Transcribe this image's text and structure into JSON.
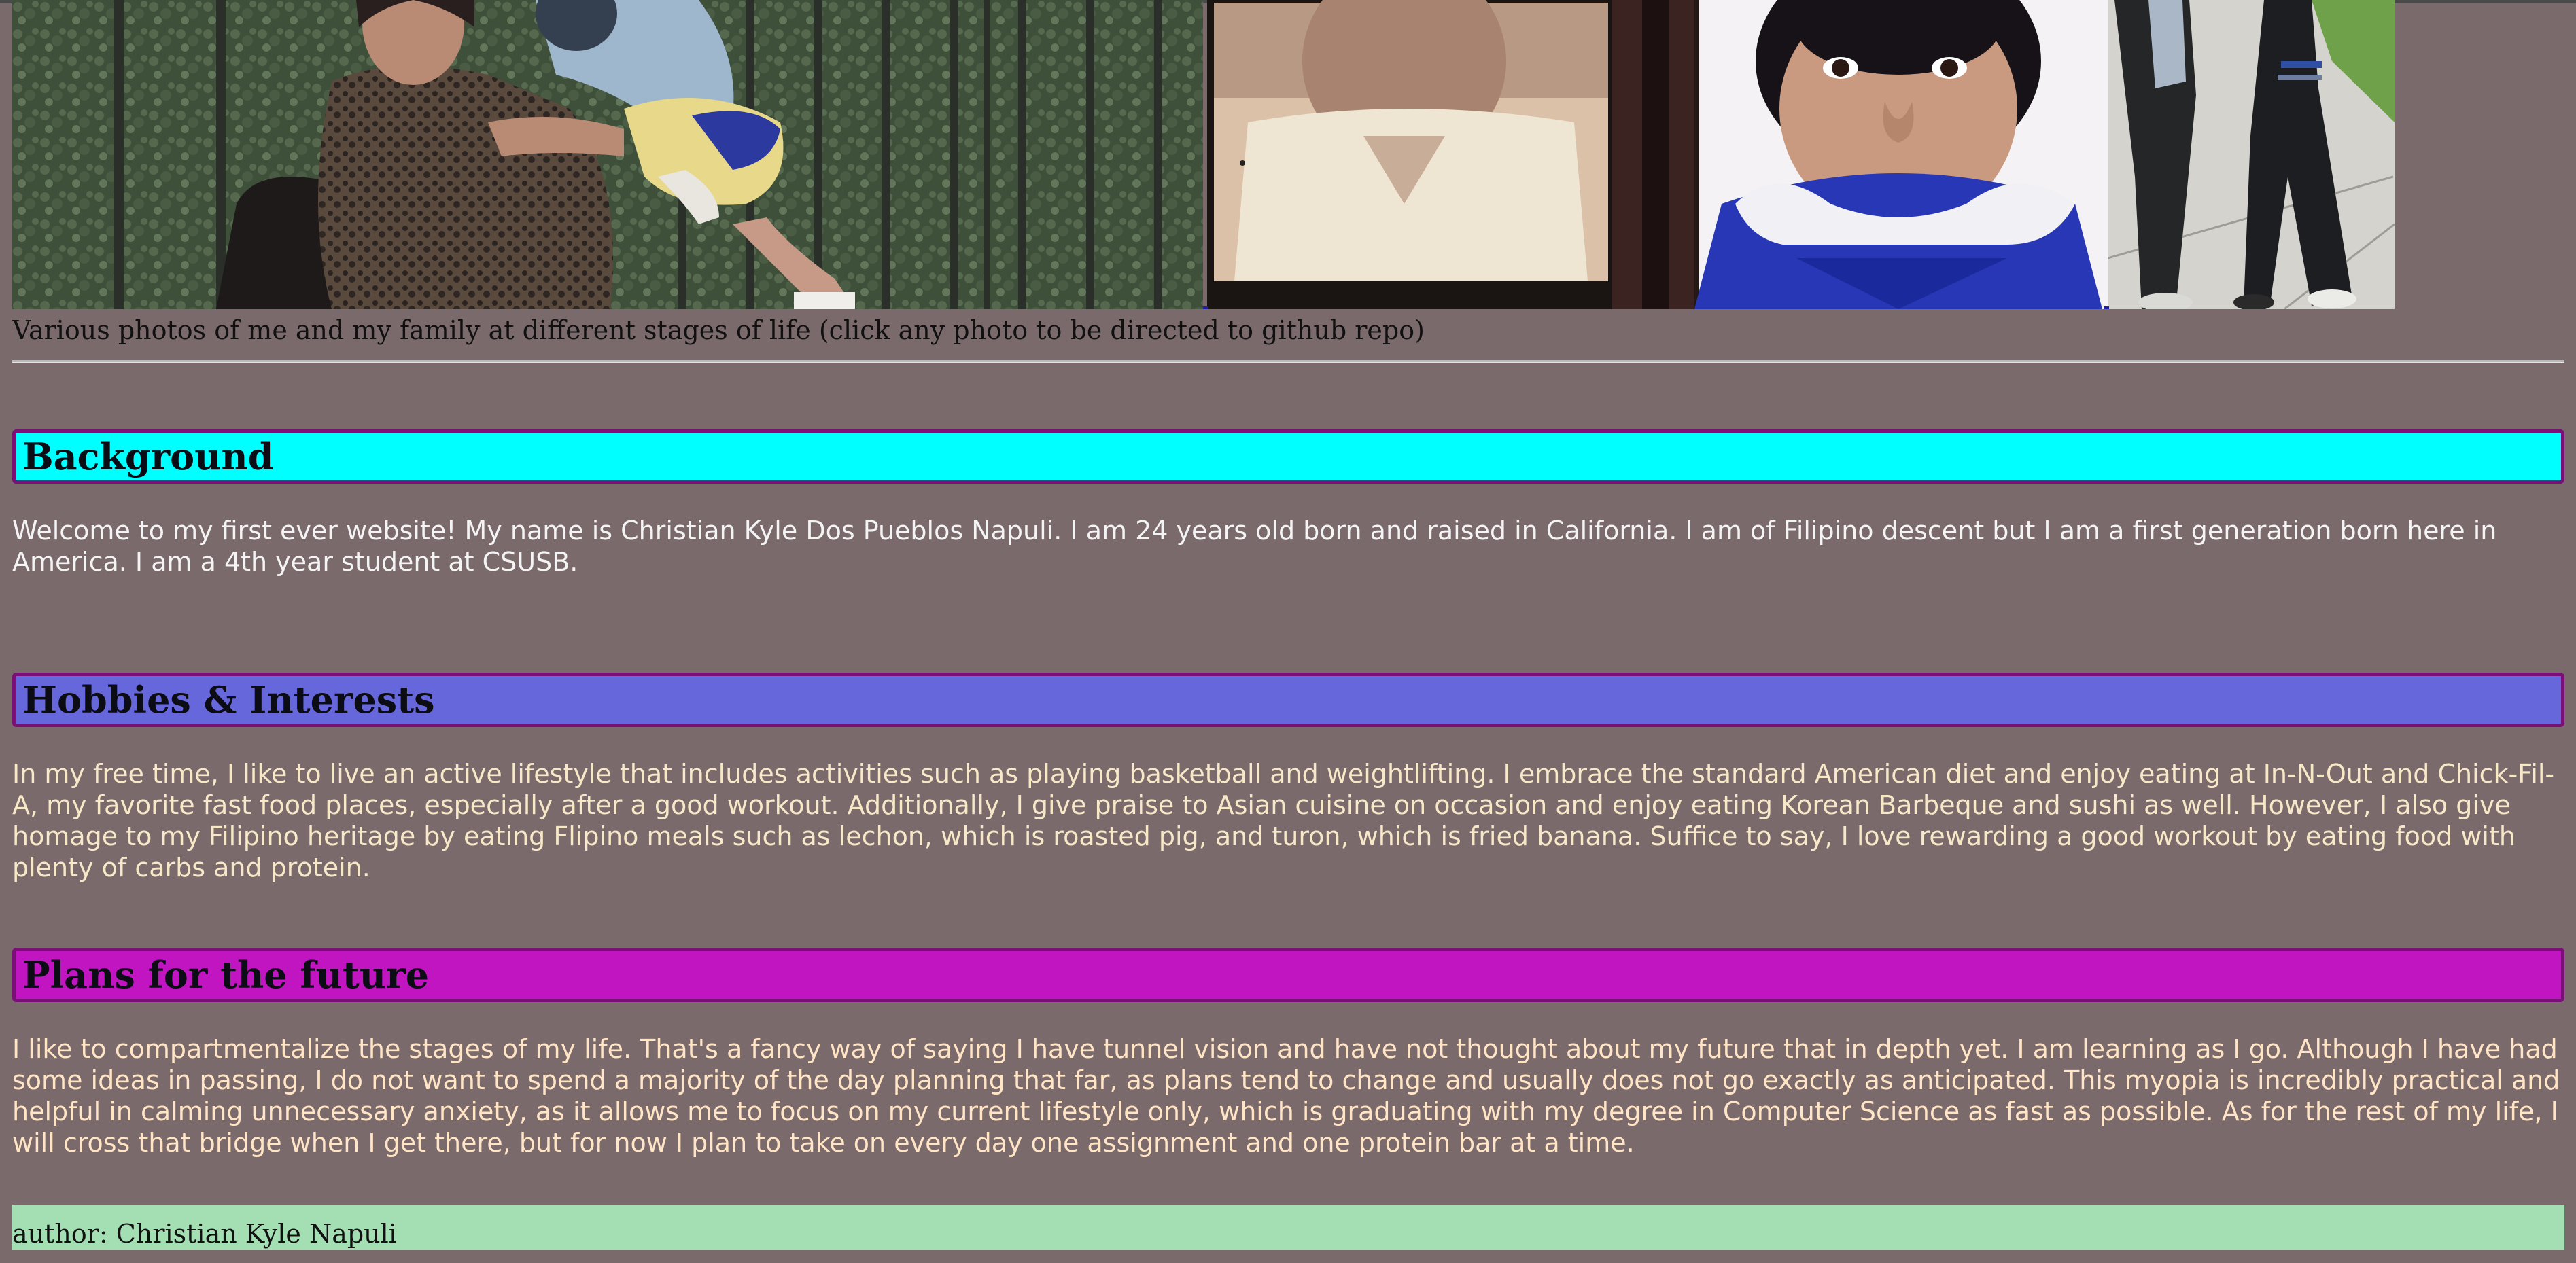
{
  "gallery": {
    "photos": [
      {
        "name": "family-photo-woman-holding-child"
      },
      {
        "name": "vintage-childhood-portrait"
      },
      {
        "name": "child-portrait-blue-jacket"
      },
      {
        "name": "walking-legs-sidewalk"
      }
    ],
    "caption": "Various photos of me and my family at different stages of life (click any photo to be directed to github repo)"
  },
  "sections": {
    "background": {
      "title": "Background",
      "body": "Welcome to my first ever website! My name is Christian Kyle Dos Pueblos Napuli. I am 24 years old born and raised in California. I am of Filipino descent but I am a first generation born here in America. I am a 4th year student at CSUSB."
    },
    "hobbies": {
      "title": "Hobbies & Interests",
      "body": "In my free time, I like to live an active lifestyle that includes activities such as playing basketball and weightlifting. I embrace the standard American diet and enjoy eating at In-N-Out and Chick-Fil-A, my favorite fast food places, especially after a good workout. Additionally, I give praise to Asian cuisine on occasion and enjoy eating Korean Barbeque and sushi as well. However, I also give homage to my Filipino heritage by eating Flipino meals such as lechon, which is roasted pig, and turon, which is fried banana. Suffice to say, I love rewarding a good workout by eating food with plenty of carbs and protein."
    },
    "plans": {
      "title": "Plans for the future",
      "body": "I like to compartmentalize the stages of my life. That's a fancy way of saying I have tunnel vision and have not thought about my future that in depth yet. I am learning as I go. Although I have had some ideas in passing, I do not want to spend a majority of the day planning that far, as plans tend to change and usually does not go exactly as anticipated. This myopia is incredibly practical and helpful in calming unnecessary anxiety, as it allows me to focus on my current lifestyle only, which is graduating with my degree in Computer Science as fast as possible. As for the rest of my life, I will cross that bridge when I get there, but for now I plan to take on every day one assignment and one protein bar at a time."
    }
  },
  "footer": {
    "author": "author: Christian Kyle Napuli"
  },
  "colors": {
    "page_background": "#7a6a6c",
    "background_heading": "#00ffff",
    "hobbies_heading": "#6767dc",
    "plans_heading": "#c115c1",
    "heading_border": "#7a0f78",
    "footer_background": "#a4dfb4"
  }
}
